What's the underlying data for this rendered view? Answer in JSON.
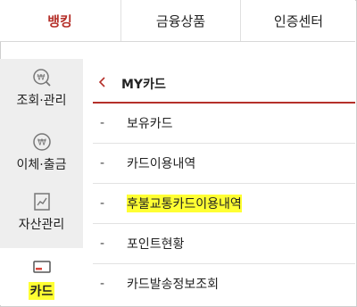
{
  "tabs": [
    {
      "label": "뱅킹",
      "active": true
    },
    {
      "label": "금융상품",
      "active": false
    },
    {
      "label": "인증센터",
      "active": false
    }
  ],
  "sidebar": {
    "items": [
      {
        "label": "조회·관리",
        "icon": "won-search-icon"
      },
      {
        "label": "이체·출금",
        "icon": "won-transfer-icon"
      },
      {
        "label": "자산관리",
        "icon": "asset-chart-icon"
      },
      {
        "label": "카드",
        "icon": "card-icon",
        "active": true,
        "highlighted": true
      }
    ]
  },
  "main": {
    "back_icon": "chevron-left-icon",
    "title": "MY카드",
    "items": [
      {
        "bullet": "-",
        "label": "보유카드"
      },
      {
        "bullet": "-",
        "label": "카드이용내역"
      },
      {
        "bullet": "-",
        "label": "후불교통카드이용내역",
        "highlighted": true
      },
      {
        "bullet": "-",
        "label": "포인트현황"
      },
      {
        "bullet": "-",
        "label": "카드발송정보조회"
      }
    ]
  },
  "colors": {
    "accent": "#b5302a",
    "highlight": "#ffff33",
    "sidebar_bg": "#eeeeee"
  }
}
